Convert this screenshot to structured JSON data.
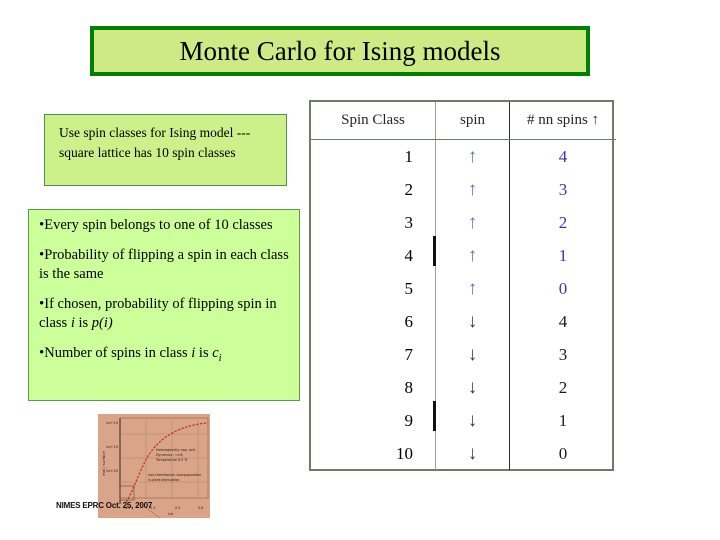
{
  "slide": {
    "title": "Monte Carlo for Ising models",
    "title_border_color": "#008000",
    "title_fill_color": "#cdea84"
  },
  "note_box": {
    "text": "Use spin classes for Ising model --- square lattice has 10 spin classes",
    "fill_color": "#ccf08a",
    "border_color": "#4f8f4f"
  },
  "bullets": {
    "fill_color": "#ccff99",
    "border_color": "#5a9a4a",
    "bullet_glyph": "•",
    "items": [
      {
        "prefix": "Every spin belongs to one of 10 classes"
      },
      {
        "prefix": "Probability of flipping a spin in each class is the same"
      },
      {
        "prefix": "If chosen, probability of flipping spin in class ",
        "italic1": "i",
        "mid": " is ",
        "italic2": "p(i)"
      },
      {
        "prefix": "Number of spins in class ",
        "italic1": "i",
        "mid": " is ",
        "italic2": "c",
        "sub": "i"
      }
    ]
  },
  "spin_table": {
    "headers": [
      "Spin Class",
      "spin",
      "# nn spins ↑"
    ],
    "header_arrow": "↑",
    "arrow_up_color": "#6a6ac4",
    "arrow_down_color": "#3a3a3a",
    "nn_blue_color": "#3838b0",
    "rows": [
      {
        "spin_class": "1",
        "spin": "↑",
        "nn_spins": "4"
      },
      {
        "spin_class": "2",
        "spin": "↑",
        "nn_spins": "3"
      },
      {
        "spin_class": "3",
        "spin": "↑",
        "nn_spins": "2"
      },
      {
        "spin_class": "4",
        "spin": "↑",
        "nn_spins": "1"
      },
      {
        "spin_class": "5",
        "spin": "↑",
        "nn_spins": "0"
      },
      {
        "spin_class": "6",
        "spin": "↓",
        "nn_spins": "4"
      },
      {
        "spin_class": "7",
        "spin": "↓",
        "nn_spins": "3"
      },
      {
        "spin_class": "8",
        "spin": "↓",
        "nn_spins": "2"
      },
      {
        "spin_class": "9",
        "spin": "↓",
        "nn_spins": "1"
      },
      {
        "spin_class": "10",
        "spin": "↓",
        "nn_spins": "0"
      }
    ]
  },
  "plot_thumbnail": {
    "background_color": "#d9a488",
    "curve_color": "#c03020",
    "ylabel": "mol / surface",
    "ytick_labels": [
      "1e+10",
      "1e+10",
      "1e+20"
    ],
    "annotation_1": "Heterogeneity nog. acti.",
    "annotation_2": "Dynamics : n=6,",
    "annotation_3": "Temperature 0.5 Tc",
    "annotation_4": "non-Hamiltonian slowpopulation",
    "annotation_5": "in-plane attenuation",
    "xtick_labels": [
      "0.1",
      "0.3",
      "0.5",
      "0.8"
    ],
    "xlabel": "Lat"
  },
  "footer": {
    "text": "NIMES EPRC Oct. 25, 2007"
  }
}
